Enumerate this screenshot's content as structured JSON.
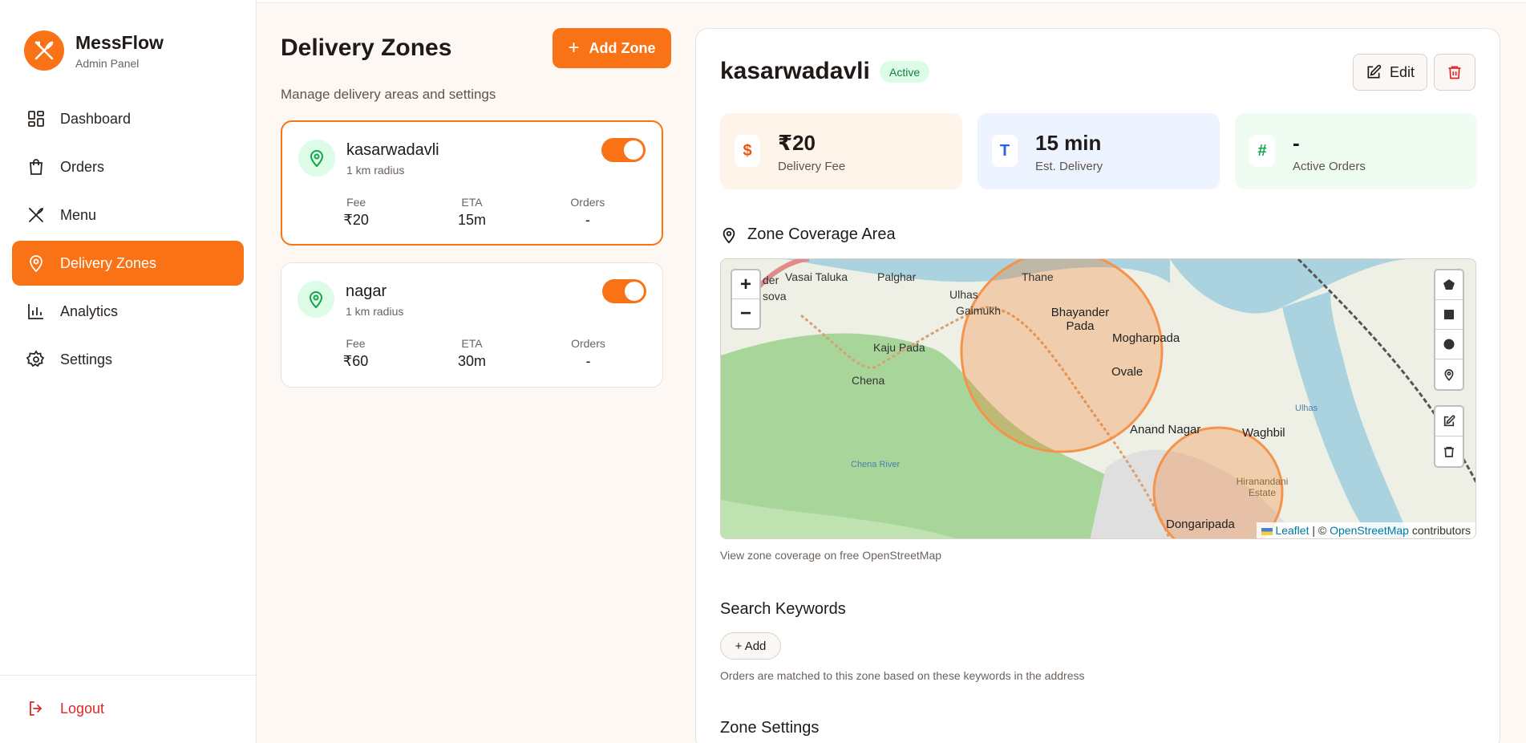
{
  "brand": {
    "name": "MessFlow",
    "subtitle": "Admin Panel"
  },
  "nav": [
    {
      "label": "Dashboard",
      "icon": "grid-icon"
    },
    {
      "label": "Orders",
      "icon": "bag-icon"
    },
    {
      "label": "Menu",
      "icon": "utensils-icon"
    },
    {
      "label": "Delivery Zones",
      "icon": "map-pin-icon",
      "active": true
    },
    {
      "label": "Analytics",
      "icon": "bar-chart-icon"
    },
    {
      "label": "Settings",
      "icon": "gear-icon"
    }
  ],
  "logout_label": "Logout",
  "page": {
    "title": "Delivery Zones",
    "subtitle": "Manage delivery areas and settings",
    "add_label": "Add Zone"
  },
  "zones": [
    {
      "name": "kasarwadavli",
      "radius": "1 km radius",
      "fee_label": "Fee",
      "fee": "₹20",
      "eta_label": "ETA",
      "eta": "15m",
      "orders_label": "Orders",
      "orders": "-",
      "enabled": true
    },
    {
      "name": "nagar",
      "radius": "1 km radius",
      "fee_label": "Fee",
      "fee": "₹60",
      "eta_label": "ETA",
      "eta": "30m",
      "orders_label": "Orders",
      "orders": "-",
      "enabled": true
    }
  ],
  "detail": {
    "name": "kasarwadavli",
    "status": "Active",
    "edit_label": "Edit",
    "stats": [
      {
        "icon_text": "$",
        "value": "₹20",
        "label": "Delivery Fee",
        "bg": "#fff4ea",
        "fg": "#ea580c"
      },
      {
        "icon_text": "T",
        "value": "15 min",
        "label": "Est. Delivery",
        "bg": "#eef4ff",
        "fg": "#2563eb"
      },
      {
        "icon_text": "#",
        "value": "-",
        "label": "Active Orders",
        "bg": "#eefcf2",
        "fg": "#16a34a"
      }
    ],
    "coverage_title": "Zone Coverage Area",
    "map": {
      "labels": [
        "Vasai Taluka",
        "Palghar",
        "Ulhas",
        "Thane",
        "Gaimukh",
        "Bhayander Pada",
        "Mogharpada",
        "Kaju Pada",
        "Chena",
        "Ovale",
        "Anand Nagar",
        "Waghbil",
        "Hiranandani Estate",
        "Dongaripada",
        "sova",
        "der",
        "Chena River",
        "Ulhas"
      ],
      "zoom_in": "+",
      "zoom_out": "−",
      "attribution_leaflet": "Leaflet",
      "attribution_sep": " | © ",
      "attribution_osm": "OpenStreetMap",
      "attribution_tail": " contributors"
    },
    "map_caption": "View zone coverage on free OpenStreetMap",
    "keywords_title": "Search Keywords",
    "keywords_add": "+ Add",
    "keywords_help": "Orders are matched to this zone based on these keywords in the address",
    "settings_title": "Zone Settings"
  },
  "colors": {
    "accent": "#f97316",
    "danger": "#dc2626",
    "success": "#15803d"
  }
}
